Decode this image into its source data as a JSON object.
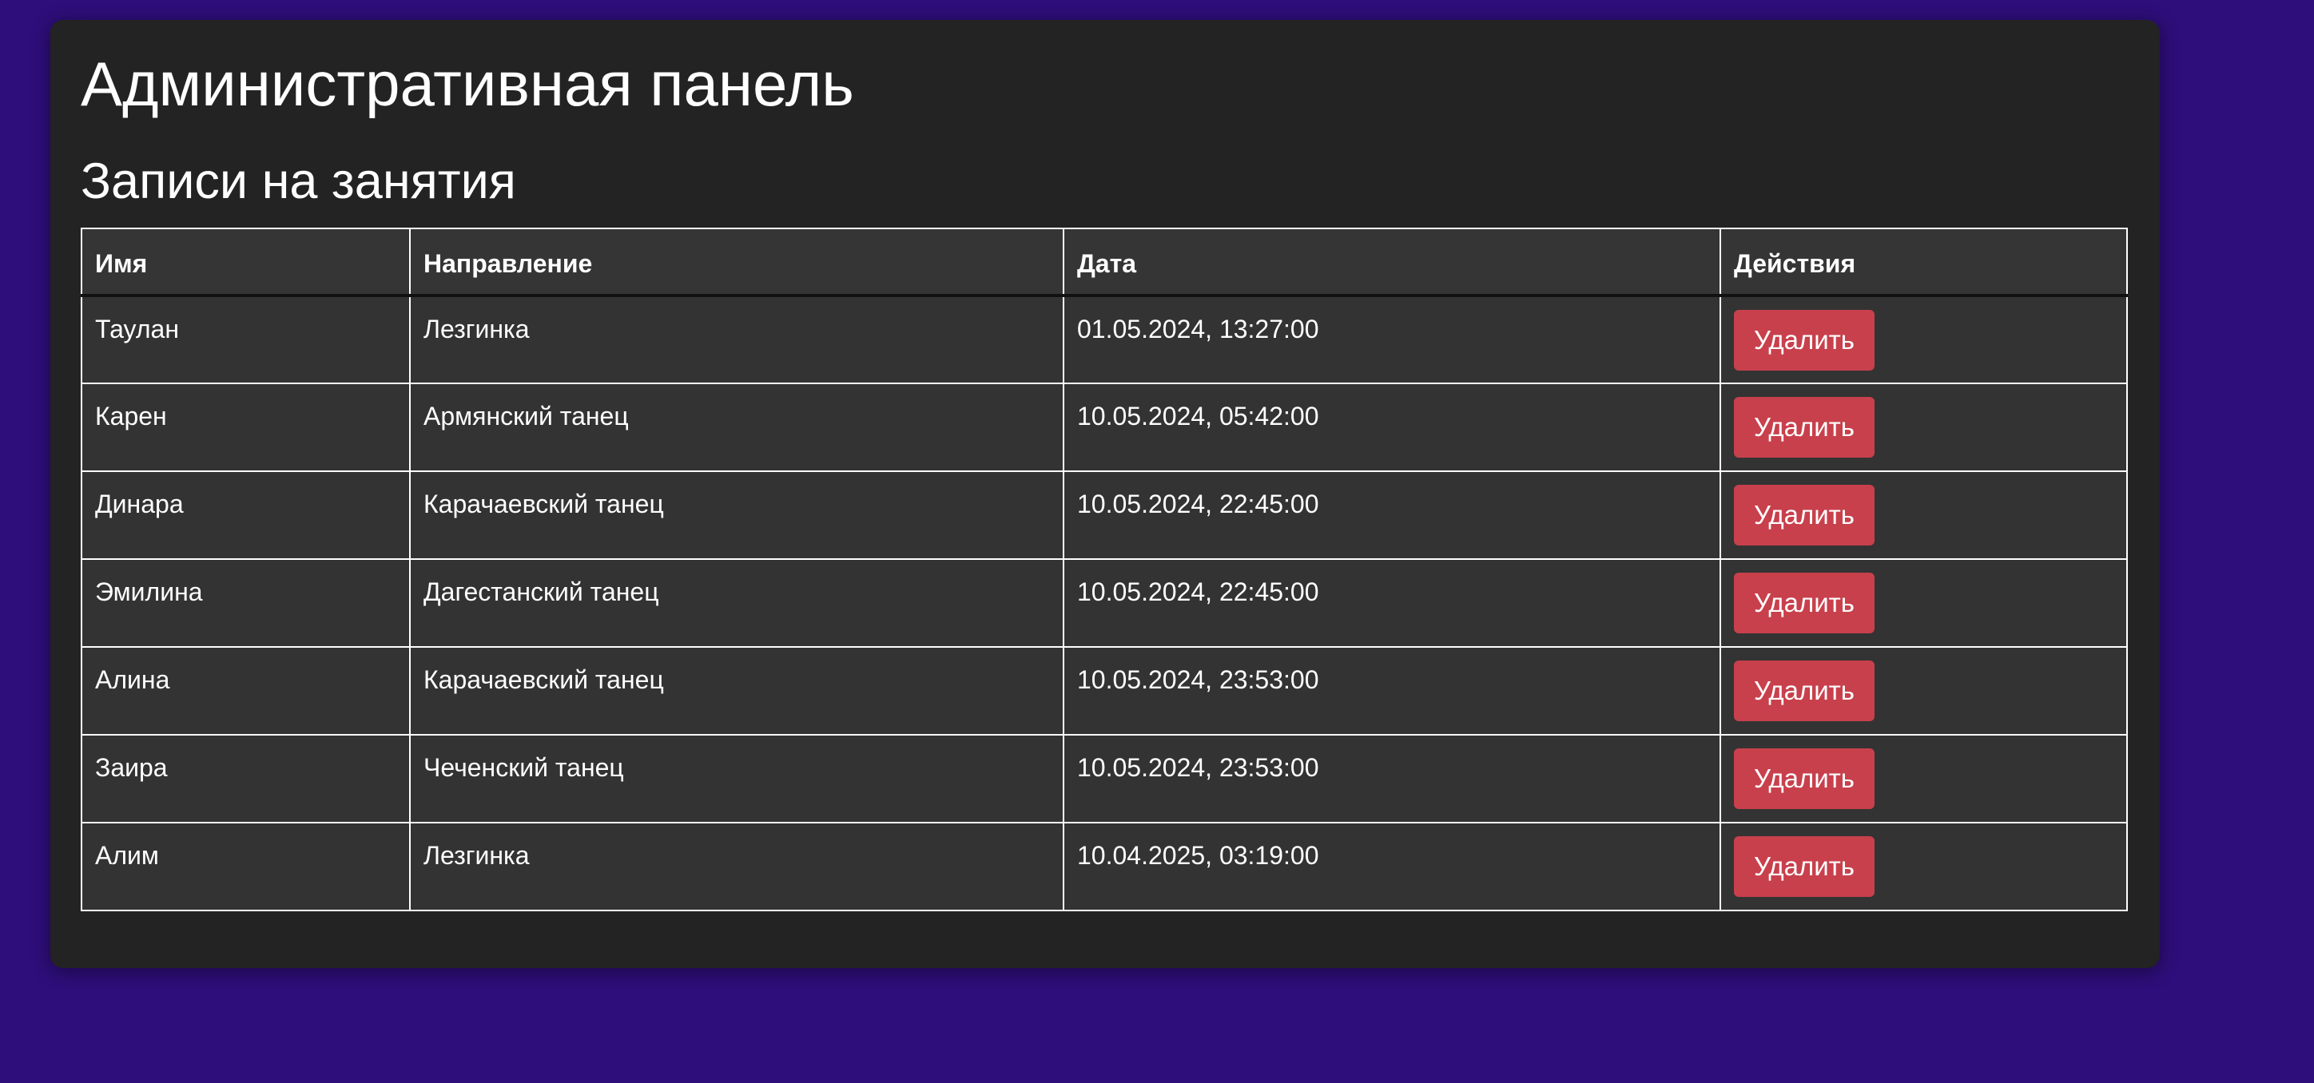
{
  "page": {
    "title": "Административная панель",
    "subtitle": "Записи на занятия"
  },
  "colors": {
    "background": "#2e0e7a",
    "panel": "#232323",
    "table": "#333333",
    "delete_button": "#c8404c"
  },
  "table": {
    "headers": {
      "name": "Имя",
      "direction": "Направление",
      "date": "Дата",
      "actions": "Действия"
    },
    "delete_label": "Удалить",
    "rows": [
      {
        "name": "Таулан",
        "direction": "Лезгинка",
        "date": "01.05.2024, 13:27:00"
      },
      {
        "name": "Карен",
        "direction": "Армянский танец",
        "date": "10.05.2024, 05:42:00"
      },
      {
        "name": "Динара",
        "direction": "Карачаевский танец",
        "date": "10.05.2024, 22:45:00"
      },
      {
        "name": "Эмилина",
        "direction": "Дагестанский танец",
        "date": "10.05.2024, 22:45:00"
      },
      {
        "name": "Алина",
        "direction": "Карачаевский танец",
        "date": "10.05.2024, 23:53:00"
      },
      {
        "name": "Заира",
        "direction": "Чеченский танец",
        "date": "10.05.2024, 23:53:00"
      },
      {
        "name": "Алим",
        "direction": "Лезгинка",
        "date": "10.04.2025, 03:19:00"
      }
    ]
  }
}
